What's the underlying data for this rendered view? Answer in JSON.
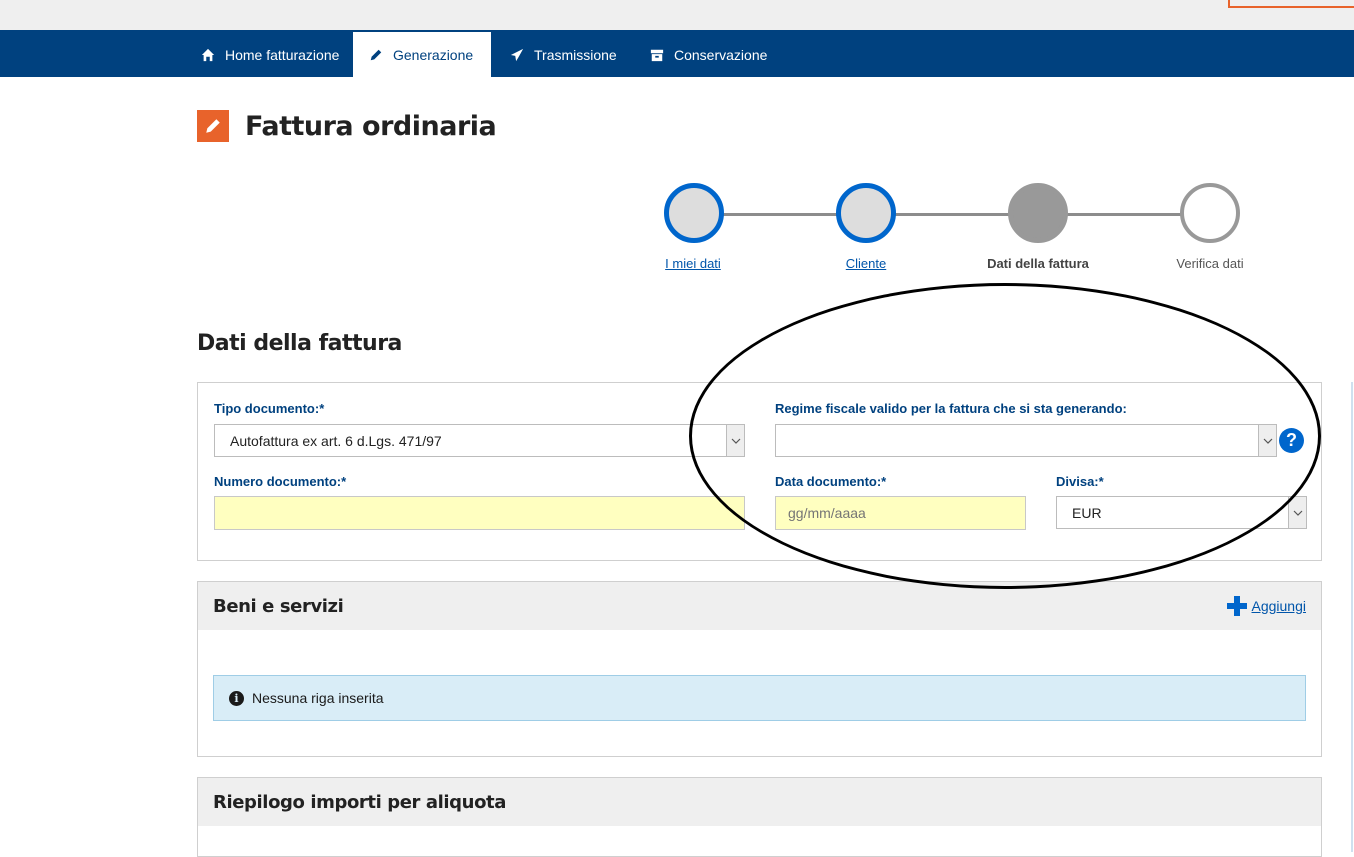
{
  "nav": {
    "items": [
      {
        "label": "Home fatturazione",
        "icon": "home-icon"
      },
      {
        "label": "Generazione",
        "icon": "pencil-icon",
        "active": true
      },
      {
        "label": "Trasmissione",
        "icon": "paper-plane-icon"
      },
      {
        "label": "Conservazione",
        "icon": "archive-box-icon"
      }
    ]
  },
  "page": {
    "title": "Fattura ordinaria",
    "title_icon": "pencil-icon"
  },
  "stepper": {
    "steps": [
      {
        "label": "I miei dati",
        "state": "done"
      },
      {
        "label": "Cliente",
        "state": "done"
      },
      {
        "label": "Dati della fattura",
        "state": "current"
      },
      {
        "label": "Verifica dati",
        "state": "todo"
      }
    ]
  },
  "form": {
    "section_title": "Dati della fattura",
    "tipo_documento": {
      "label": "Tipo documento:*",
      "value": "Autofattura ex art. 6 d.Lgs. 471/97"
    },
    "regime_fiscale": {
      "label": "Regime fiscale valido per la fattura che si sta generando:",
      "value": ""
    },
    "numero_documento": {
      "label": "Numero documento:*",
      "value": "",
      "placeholder": ""
    },
    "data_documento": {
      "label": "Data documento:*",
      "value": "",
      "placeholder": "gg/mm/aaaa"
    },
    "divisa": {
      "label": "Divisa:*",
      "value": "EUR"
    }
  },
  "beni_servizi": {
    "title": "Beni e servizi",
    "add_label": "Aggiungi",
    "empty_message": "Nessuna riga inserita"
  },
  "riepilogo": {
    "title": "Riepilogo importi per aliquota"
  },
  "colors": {
    "nav_bg": "#00417f",
    "accent_orange": "#e8632b",
    "link_blue": "#0055aa",
    "required_input_bg": "#ffffc0"
  }
}
